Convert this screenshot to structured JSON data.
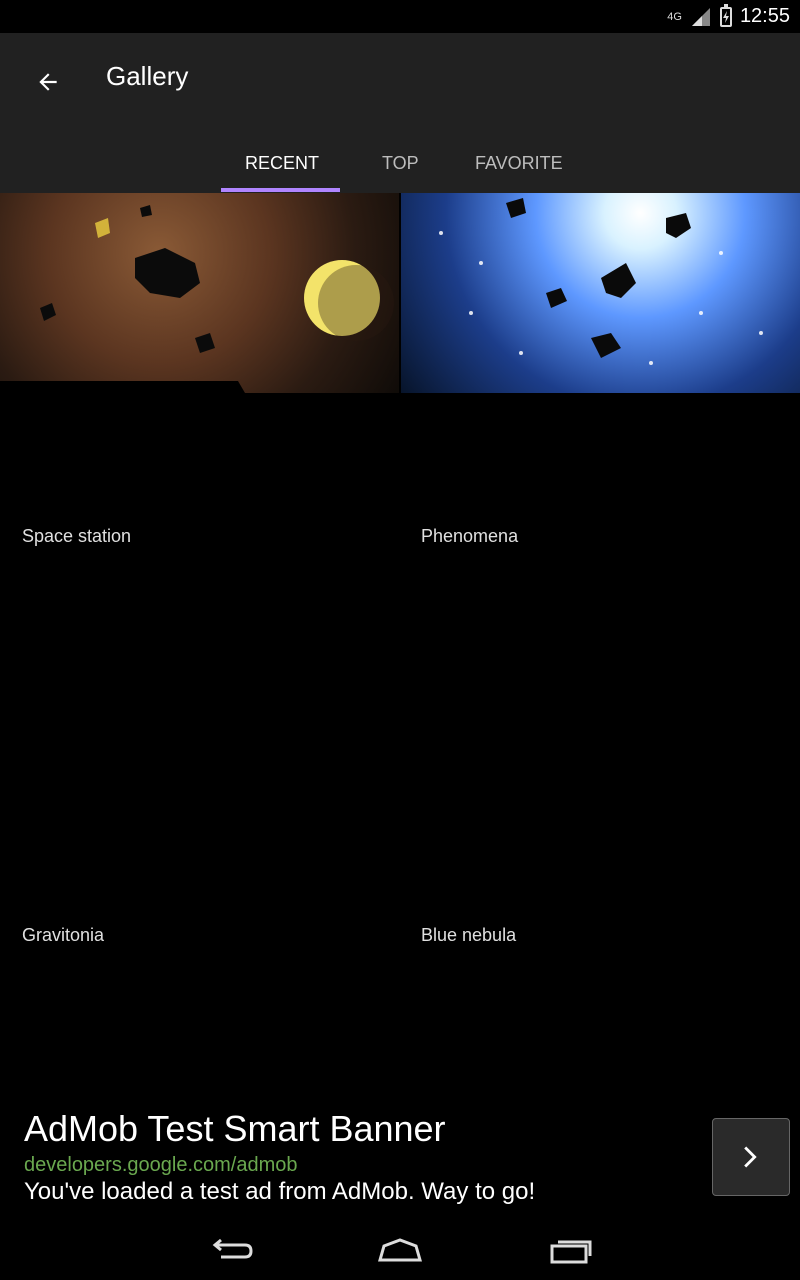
{
  "status": {
    "time": "12:55",
    "network": "4G"
  },
  "appbar": {
    "title": "Gallery"
  },
  "tabs": [
    {
      "label": "RECENT",
      "active": true
    },
    {
      "label": "TOP",
      "active": false
    },
    {
      "label": "FAVORITE",
      "active": false
    }
  ],
  "grid": [
    {
      "name": "Space station"
    },
    {
      "name": "Phenomena"
    },
    {
      "name": "Gravitonia"
    },
    {
      "name": "Blue nebula"
    }
  ],
  "ad": {
    "title": "AdMob Test Smart Banner",
    "url": "developers.google.com/admob",
    "text": "You've loaded a test ad from AdMob. Way to go!"
  },
  "colors": {
    "appbar": "#212121",
    "indicator": "#b085ff",
    "ad_url": "#6aa84f"
  },
  "icons": {
    "back": "arrow-left-icon",
    "ad_next": "chevron-right-icon",
    "nav_back": "back-nav-icon",
    "nav_home": "home-nav-icon",
    "nav_recents": "recents-nav-icon"
  }
}
